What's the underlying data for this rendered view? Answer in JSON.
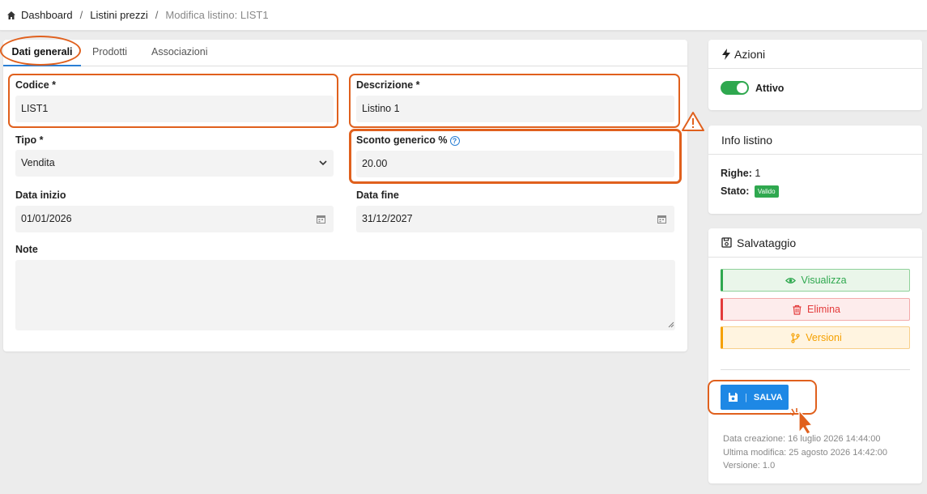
{
  "breadcrumb": {
    "items": [
      "Dashboard",
      "Listini prezzi"
    ],
    "current": "Modifica listino: LIST1",
    "separator": "/"
  },
  "tabs": [
    {
      "label": "Dati generali",
      "active": true
    },
    {
      "label": "Prodotti",
      "active": false
    },
    {
      "label": "Associazioni",
      "active": false
    }
  ],
  "form": {
    "codice": {
      "label": "Codice *",
      "value": "LIST1"
    },
    "descrizione": {
      "label": "Descrizione *",
      "value": "Listino 1"
    },
    "tipo": {
      "label": "Tipo *",
      "value": "Vendita"
    },
    "sconto": {
      "label": "Sconto generico %",
      "value": "20.00"
    },
    "data_inizio": {
      "label": "Data inizio",
      "value": "01/01/2026"
    },
    "data_fine": {
      "label": "Data fine",
      "value": "31/12/2027"
    },
    "note": {
      "label": "Note",
      "value": ""
    }
  },
  "azioni": {
    "title": "Azioni",
    "toggle_label": "Attivo",
    "toggle_on": true
  },
  "info": {
    "title": "Info listino",
    "righe_label": "Righe:",
    "righe_value": "1",
    "stato_label": "Stato:",
    "stato_value": "Valido"
  },
  "salvataggio": {
    "title": "Salvataggio",
    "buttons": {
      "visualizza": "Visualizza",
      "elimina": "Elimina",
      "versioni": "Versioni"
    },
    "save_label": "SALVA",
    "save_separator": "|"
  },
  "meta": {
    "creazione": "Data creazione: 16 luglio 2026 14:44:00",
    "modifica": "Ultima modifica: 25 agosto 2026 14:42:00",
    "versione": "Versione: 1.0"
  },
  "colors": {
    "accent": "#2a7fd4",
    "annotation": "#e0601d",
    "success": "#2fa84f",
    "danger": "#e33b3b",
    "warning": "#f5a000",
    "primary_button": "#1e88e5"
  }
}
